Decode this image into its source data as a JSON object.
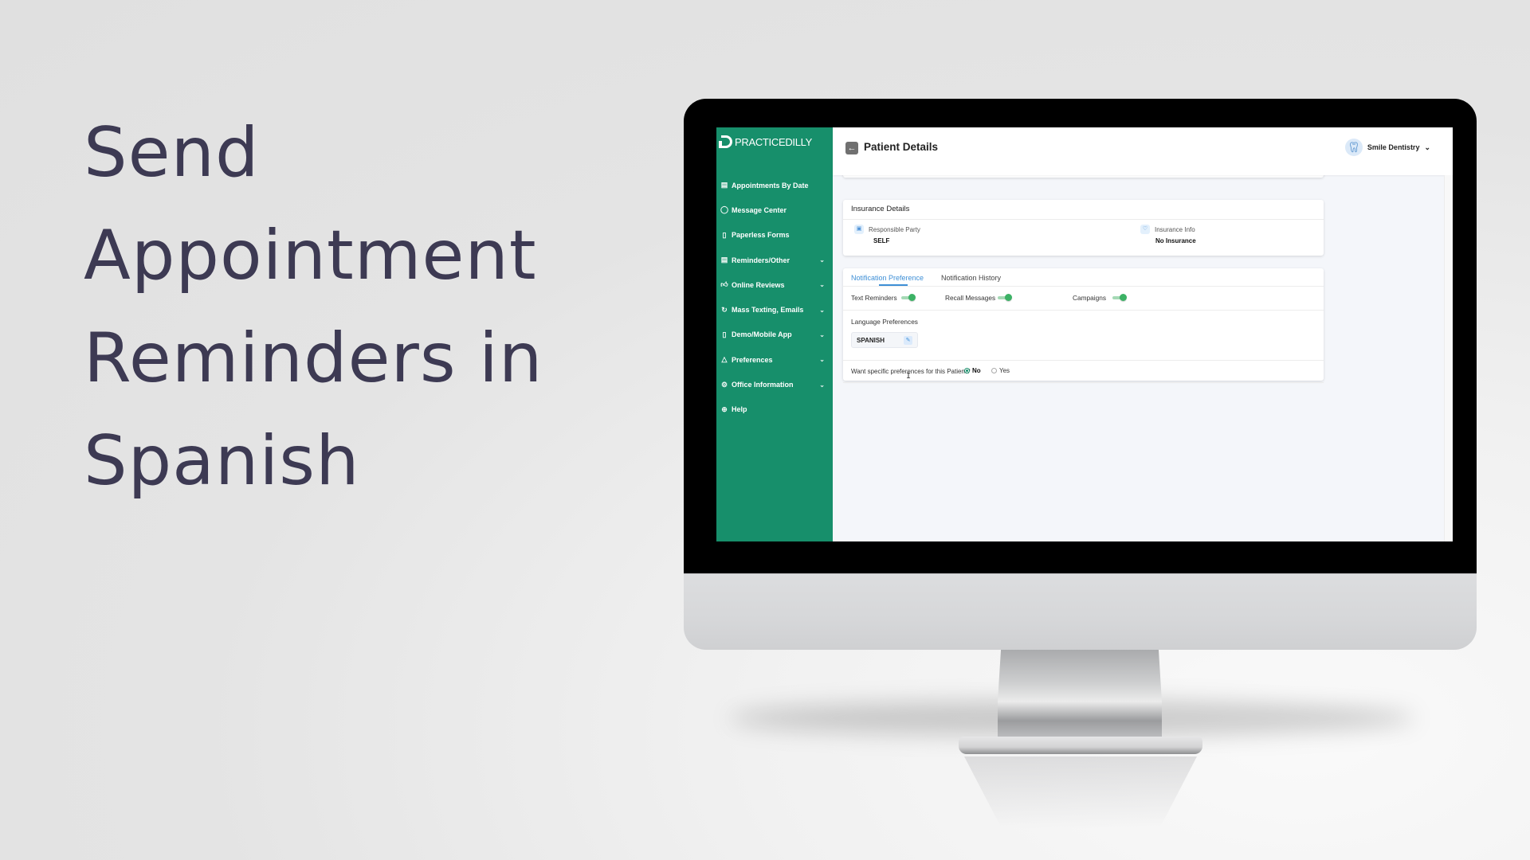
{
  "headline": {
    "lines": [
      "Send",
      "Appointment",
      "Reminders in",
      "Spanish"
    ],
    "color": "#3d3a53"
  },
  "app": {
    "brand": "PRACTICEDILLY",
    "brand_color": "#178f6b",
    "accent_color": "#3e8fd6",
    "toggle_on_color": "#3cb265"
  },
  "sidebar": {
    "items": [
      {
        "label": "Appointments By Date",
        "icon": "calendar-icon",
        "expandable": false
      },
      {
        "label": "Message Center",
        "icon": "chat-bubble-icon",
        "expandable": false
      },
      {
        "label": "Paperless Forms",
        "icon": "document-icon",
        "expandable": false
      },
      {
        "label": "Reminders/Other",
        "icon": "calendar-icon",
        "expandable": true
      },
      {
        "label": "Online Reviews",
        "icon": "thumbs-up-icon",
        "expandable": true
      },
      {
        "label": "Mass Texting, Emails",
        "icon": "refresh-icon",
        "expandable": true
      },
      {
        "label": "Demo/Mobile App",
        "icon": "mobile-phone-icon",
        "expandable": true
      },
      {
        "label": "Preferences",
        "icon": "bell-icon",
        "expandable": true
      },
      {
        "label": "Office Information",
        "icon": "gear-icon",
        "expandable": true
      },
      {
        "label": "Help",
        "icon": "lifebuoy-icon",
        "expandable": false
      }
    ]
  },
  "header": {
    "title": "Patient Details",
    "back_icon": "arrow-left-icon",
    "practice_name": "Smile Dentistry",
    "avatar_icon": "tooth-icon"
  },
  "insurance": {
    "title": "Insurance Details",
    "responsible_party": {
      "label": "Responsible Party",
      "value": "SELF",
      "icon": "briefcase-icon"
    },
    "insurance_info": {
      "label": "Insurance Info",
      "value": "No Insurance",
      "icon": "heart-icon"
    }
  },
  "notifications": {
    "tabs": [
      {
        "label": "Notification Preference",
        "active": true
      },
      {
        "label": "Notification History",
        "active": false
      }
    ],
    "toggles": [
      {
        "label": "Text Reminders",
        "on": true
      },
      {
        "label": "Recall Messages",
        "on": true
      },
      {
        "label": "Campaigns",
        "on": true
      }
    ],
    "language": {
      "label": "Language Preferences",
      "value": "SPANISH",
      "edit_icon": "pencil-icon"
    },
    "specific_preferences": {
      "question": "Want specific preferences for this Patient?",
      "options": [
        {
          "label": "No",
          "selected": true
        },
        {
          "label": "Yes",
          "selected": false
        }
      ]
    }
  }
}
